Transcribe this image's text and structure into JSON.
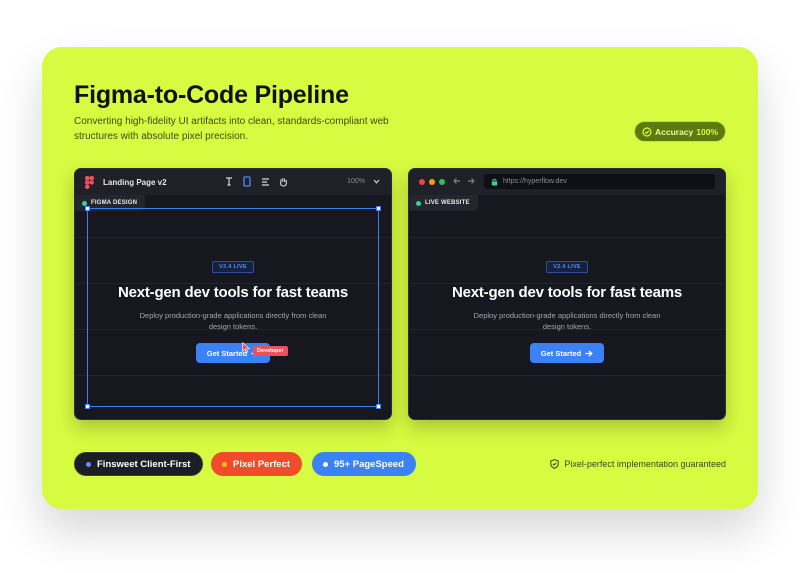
{
  "header": {
    "title": "Figma-to-Code Pipeline",
    "subtitle": "Converting high-fidelity UI artifacts into clean, standards-compliant web structures with absolute pixel precision."
  },
  "accuracy": {
    "label": "Accuracy",
    "value": "100%"
  },
  "figma_panel": {
    "doc_name": "Landing Page v2",
    "zoom": "100%",
    "tag": "FIGMA DESIGN",
    "version_badge": "V2.4 LIVE",
    "headline": "Next-gen dev tools for fast teams",
    "description": "Deploy production-grade applications directly from clean design tokens.",
    "cta": "Get Started",
    "cursor_label": "Developer"
  },
  "web_panel": {
    "url": "https://hyperflow.dev",
    "tag": "LIVE WEBSITE",
    "version_badge": "V2.4 LIVE",
    "headline": "Next-gen dev tools for fast teams",
    "description": "Deploy production-grade applications directly from clean design tokens.",
    "cta": "Get Started"
  },
  "pills": [
    {
      "label": "Finsweet Client-First",
      "dot_color": "#6b8cff"
    },
    {
      "label": "Pixel Perfect",
      "dot_color": "#fbbf24"
    },
    {
      "label": "95+ PageSpeed",
      "dot_color": "#ffffff"
    }
  ],
  "footer": {
    "guarantee": "Pixel-perfect implementation guaranteed"
  },
  "colors": {
    "accent": "#d7fb41",
    "panel": "#16171f",
    "cta": "#3b82f6",
    "pixel_perfect": "#f04b2b"
  }
}
